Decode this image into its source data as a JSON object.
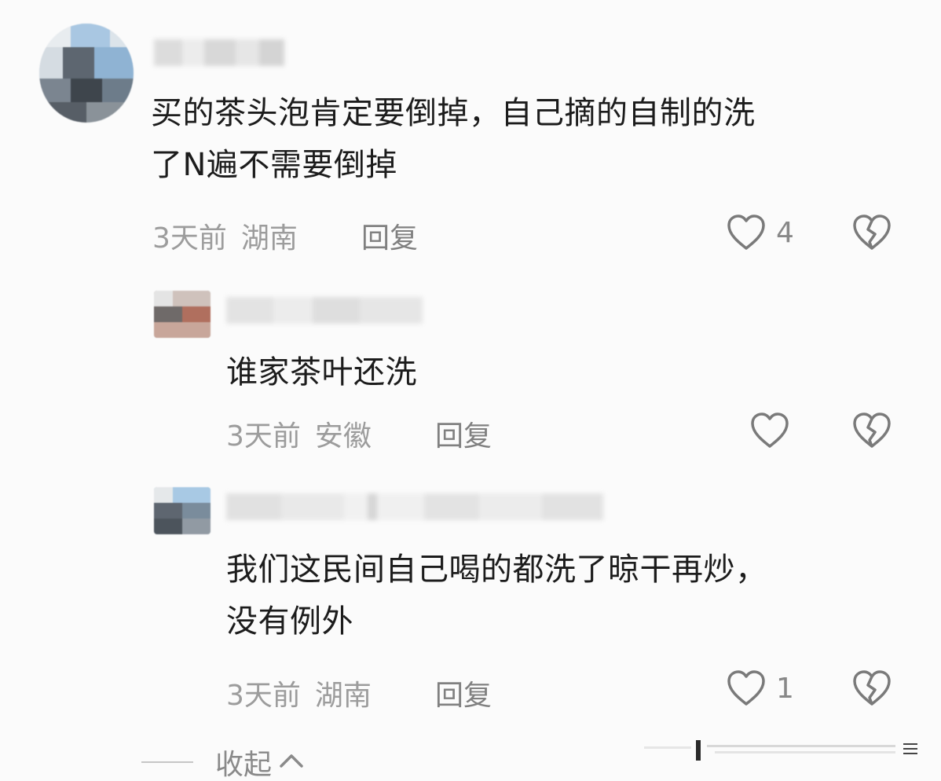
{
  "comments": [
    {
      "text": "买的茶头泡肯定要倒掉，自己摘的自制的洗\n了N遍不需要倒掉",
      "time": "3天前",
      "location": "湖南",
      "reply_label": "回复",
      "like_count": "4"
    },
    {
      "text": "谁家茶叶还洗",
      "time": "3天前",
      "location": "安徽",
      "reply_label": "回复",
      "like_count": ""
    },
    {
      "text": "我们这民间自己喝的都洗了晾干再炒，\n没有例外",
      "time": "3天前",
      "location": "湖南",
      "reply_label": "回复",
      "like_count": "1"
    }
  ],
  "collapse_label": "收起",
  "icons": {
    "like": "heart-outline-icon",
    "dislike": "broken-heart-icon",
    "collapse": "chevron-up-icon"
  },
  "colors": {
    "text": "#1c1c1c",
    "meta": "#9c9c9c",
    "icon": "#7a7a7a"
  }
}
